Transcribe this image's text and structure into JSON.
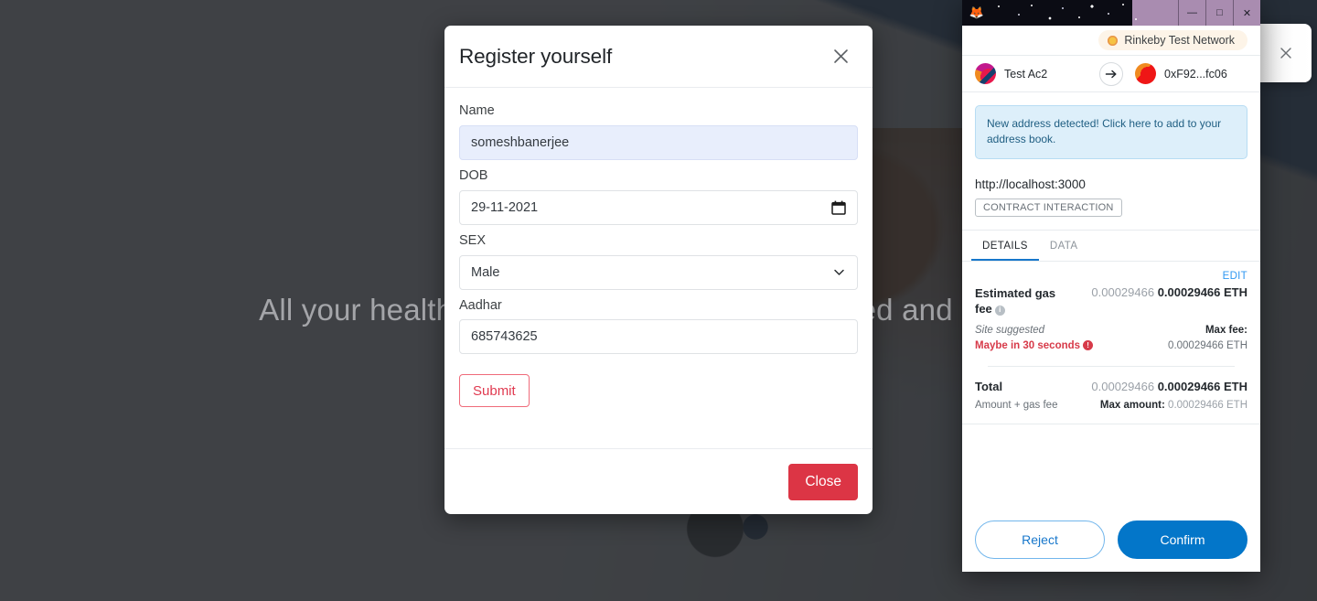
{
  "background": {
    "headline": "All your health records at one place, Encrypted and Secure"
  },
  "modal": {
    "title": "Register yourself",
    "close_icon": "close-icon",
    "fields": [
      {
        "label": "Name",
        "value": "someshbanerjee",
        "type": "text",
        "icon": ""
      },
      {
        "label": "DOB",
        "value": "29-11-2021",
        "type": "date",
        "icon": "calendar-icon"
      },
      {
        "label": "SEX",
        "value": "Male",
        "type": "select",
        "icon": "chevron-down-icon"
      },
      {
        "label": "Aadhar",
        "value": "685743625",
        "type": "text",
        "icon": ""
      }
    ],
    "submit_label": "Submit",
    "close_label": "Close",
    "accent_red": "#dc3545",
    "autofill_blue": "#e8eefc"
  },
  "side_panel": {
    "close_icon": "close-icon"
  },
  "metamask": {
    "titlebar": {
      "app_icon": "metamask-fox-icon",
      "minimize": "—",
      "maximize": "□",
      "close": "✕"
    },
    "network": {
      "label": "Rinkeby Test Network",
      "dot_color": "#f6c343"
    },
    "accounts": {
      "from": "Test Ac2",
      "to": "0xF92...fc06",
      "arrow_icon": "arrow-right-icon"
    },
    "alert": "New address detected! Click here to add to your address book.",
    "origin": {
      "url": "http://localhost:3000",
      "tag": "CONTRACT INTERACTION"
    },
    "tabs": [
      {
        "label": "DETAILS",
        "active": true
      },
      {
        "label": "DATA",
        "active": false
      }
    ],
    "edit_label": "EDIT",
    "gas": {
      "label": "Estimated gas fee",
      "fiat": "0.00029466",
      "amount": "0.00029466 ETH",
      "site_suggested": "Site suggested",
      "time_estimate": "Maybe in 30 seconds",
      "max_fee_label": "Max fee:",
      "max_fee_value": "0.00029466 ETH"
    },
    "total": {
      "label": "Total",
      "fiat": "0.00029466",
      "amount": "0.00029466 ETH",
      "sub_label": "Amount + gas fee",
      "max_amount_label": "Max amount:",
      "max_amount_value": "0.00029466 ETH"
    },
    "actions": {
      "reject": "Reject",
      "confirm": "Confirm"
    },
    "accent_blue": "#0376c9"
  }
}
